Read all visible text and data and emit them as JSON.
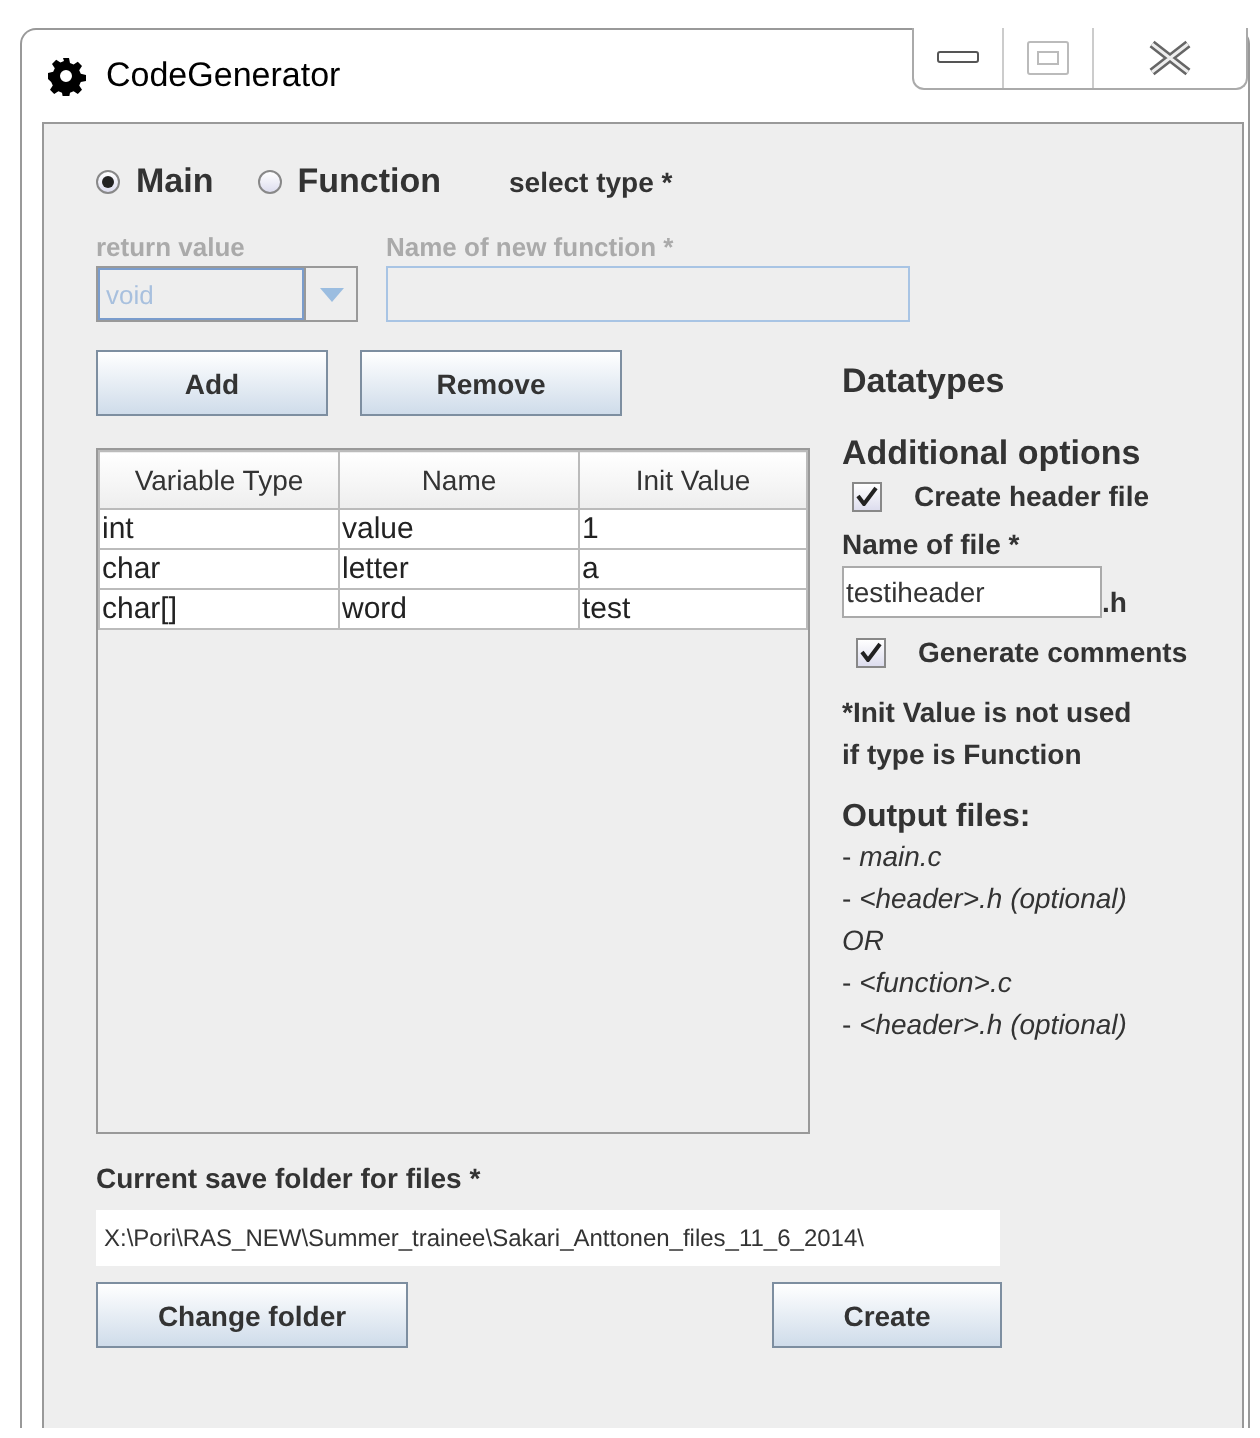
{
  "window": {
    "title": "CodeGenerator"
  },
  "type_options": [
    {
      "label": "Main",
      "selected": true
    },
    {
      "label": "Function",
      "selected": false
    }
  ],
  "select_type_label": "select type *",
  "return_value": {
    "label": "return value",
    "value": "void",
    "disabled": true
  },
  "function_name": {
    "label": "Name of new function *",
    "disabled": true
  },
  "table_buttons": [
    "Add",
    "Remove"
  ],
  "datatypes_heading": "Datatypes",
  "table": {
    "columns": [
      "Variable Type",
      "Name",
      "Init Value"
    ],
    "rows": [
      [
        "int",
        "value",
        "1"
      ],
      [
        "char",
        "letter",
        "a"
      ],
      [
        "char[]",
        "word",
        "test"
      ]
    ]
  },
  "additional_options": {
    "heading": "Additional options",
    "create_header": {
      "label": "Create header file",
      "checked": true
    },
    "file_name_label": "Name of file *",
    "file_name": "testiheader",
    "suffix": ".h",
    "generate_comments": {
      "label": "Generate comments",
      "checked": true
    },
    "note": [
      "*Init Value is not used",
      "if type is Function"
    ],
    "output_heading": "Output files:",
    "output_lines": [
      "- *main.c*",
      "- *<header>.h (optional)*",
      "*OR*",
      "- *<function>.c*",
      "- *<header>.h (optional)*"
    ]
  },
  "save_folder": {
    "label": "Current save folder for files *",
    "path": "X:\\Pori\\RAS_NEW\\Summer_trainee\\Sakari_Anttonen_files_11_6_2014\\"
  },
  "bottom_buttons": [
    "Change folder",
    "Create"
  ]
}
